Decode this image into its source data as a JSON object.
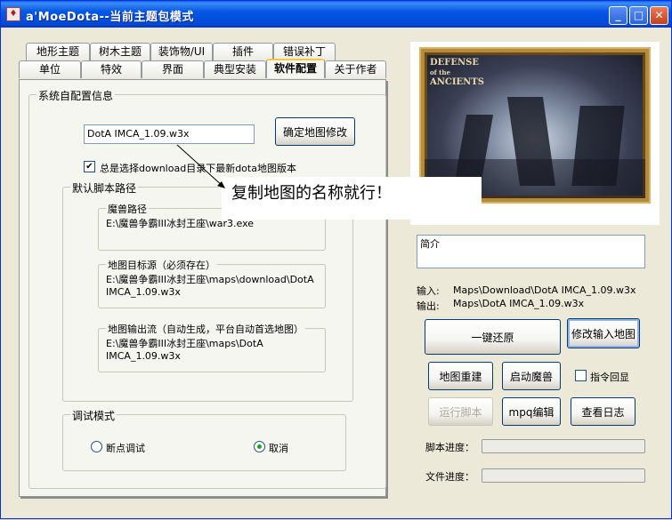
{
  "window": {
    "title": "a'MoeDota--当前主题包模式"
  },
  "tabs": {
    "row1": [
      "地形主题",
      "树木主题",
      "装饰物/UI",
      "插件",
      "错误补丁"
    ],
    "row2": [
      "单位",
      "特效",
      "界面",
      "典型安装",
      "软件配置",
      "关于作者"
    ],
    "active": "软件配置"
  },
  "config": {
    "group_title": "系统自配置信息",
    "map_name_value": "DotA IMCA_1.09.w3x",
    "confirm_button": "确定地图修改",
    "checkbox_label": "总是选择download目录下最新dota地图版本",
    "checkbox_checked": true,
    "scripts_group_title": "默认脚本路径",
    "paths": [
      {
        "title": "魔兽路径",
        "value": "E:\\魔兽争霸III冰封王座\\war3.exe"
      },
      {
        "title": "地图目标源（必须存在）",
        "value_line1": "E:\\魔兽争霸III冰封王座\\maps\\download\\DotA",
        "value_line2": "IMCA_1.09.w3x"
      },
      {
        "title": "地图输出流（自动生成，平台自动首选地图）",
        "value_line1": "E:\\魔兽争霸III冰封王座\\maps\\DotA",
        "value_line2": "IMCA_1.09.w3x"
      }
    ],
    "debug_group_title": "调试模式",
    "radio_breakpoint": "断点调试",
    "radio_cancel": "取消",
    "radio_selected": "取消"
  },
  "tooltip": {
    "text": "复制地图的名称就行！"
  },
  "preview": {
    "logo_line1": "DEFENSE",
    "logo_line2": "of the",
    "logo_line3": "ANCIENTS"
  },
  "right": {
    "intro_placeholder": "简介",
    "input_label": "输入:",
    "input_value": "Maps\\Download\\DotA IMCA_1.09.w3x",
    "output_label": "输出:",
    "output_value": "Maps\\DotA IMCA_1.09.w3x",
    "restore_button": "一键还原",
    "modify_input_button": "修改输入地图",
    "rebuild_button": "地图重建",
    "launch_button": "启动魔兽",
    "echo_label": "指令回显",
    "run_script_button": "运行脚本",
    "mpq_button": "mpq编辑",
    "log_button": "查看日志",
    "script_progress_label": "脚本进度：",
    "file_progress_label": "文件进度：",
    "script_progress": 0,
    "file_progress": 0
  }
}
